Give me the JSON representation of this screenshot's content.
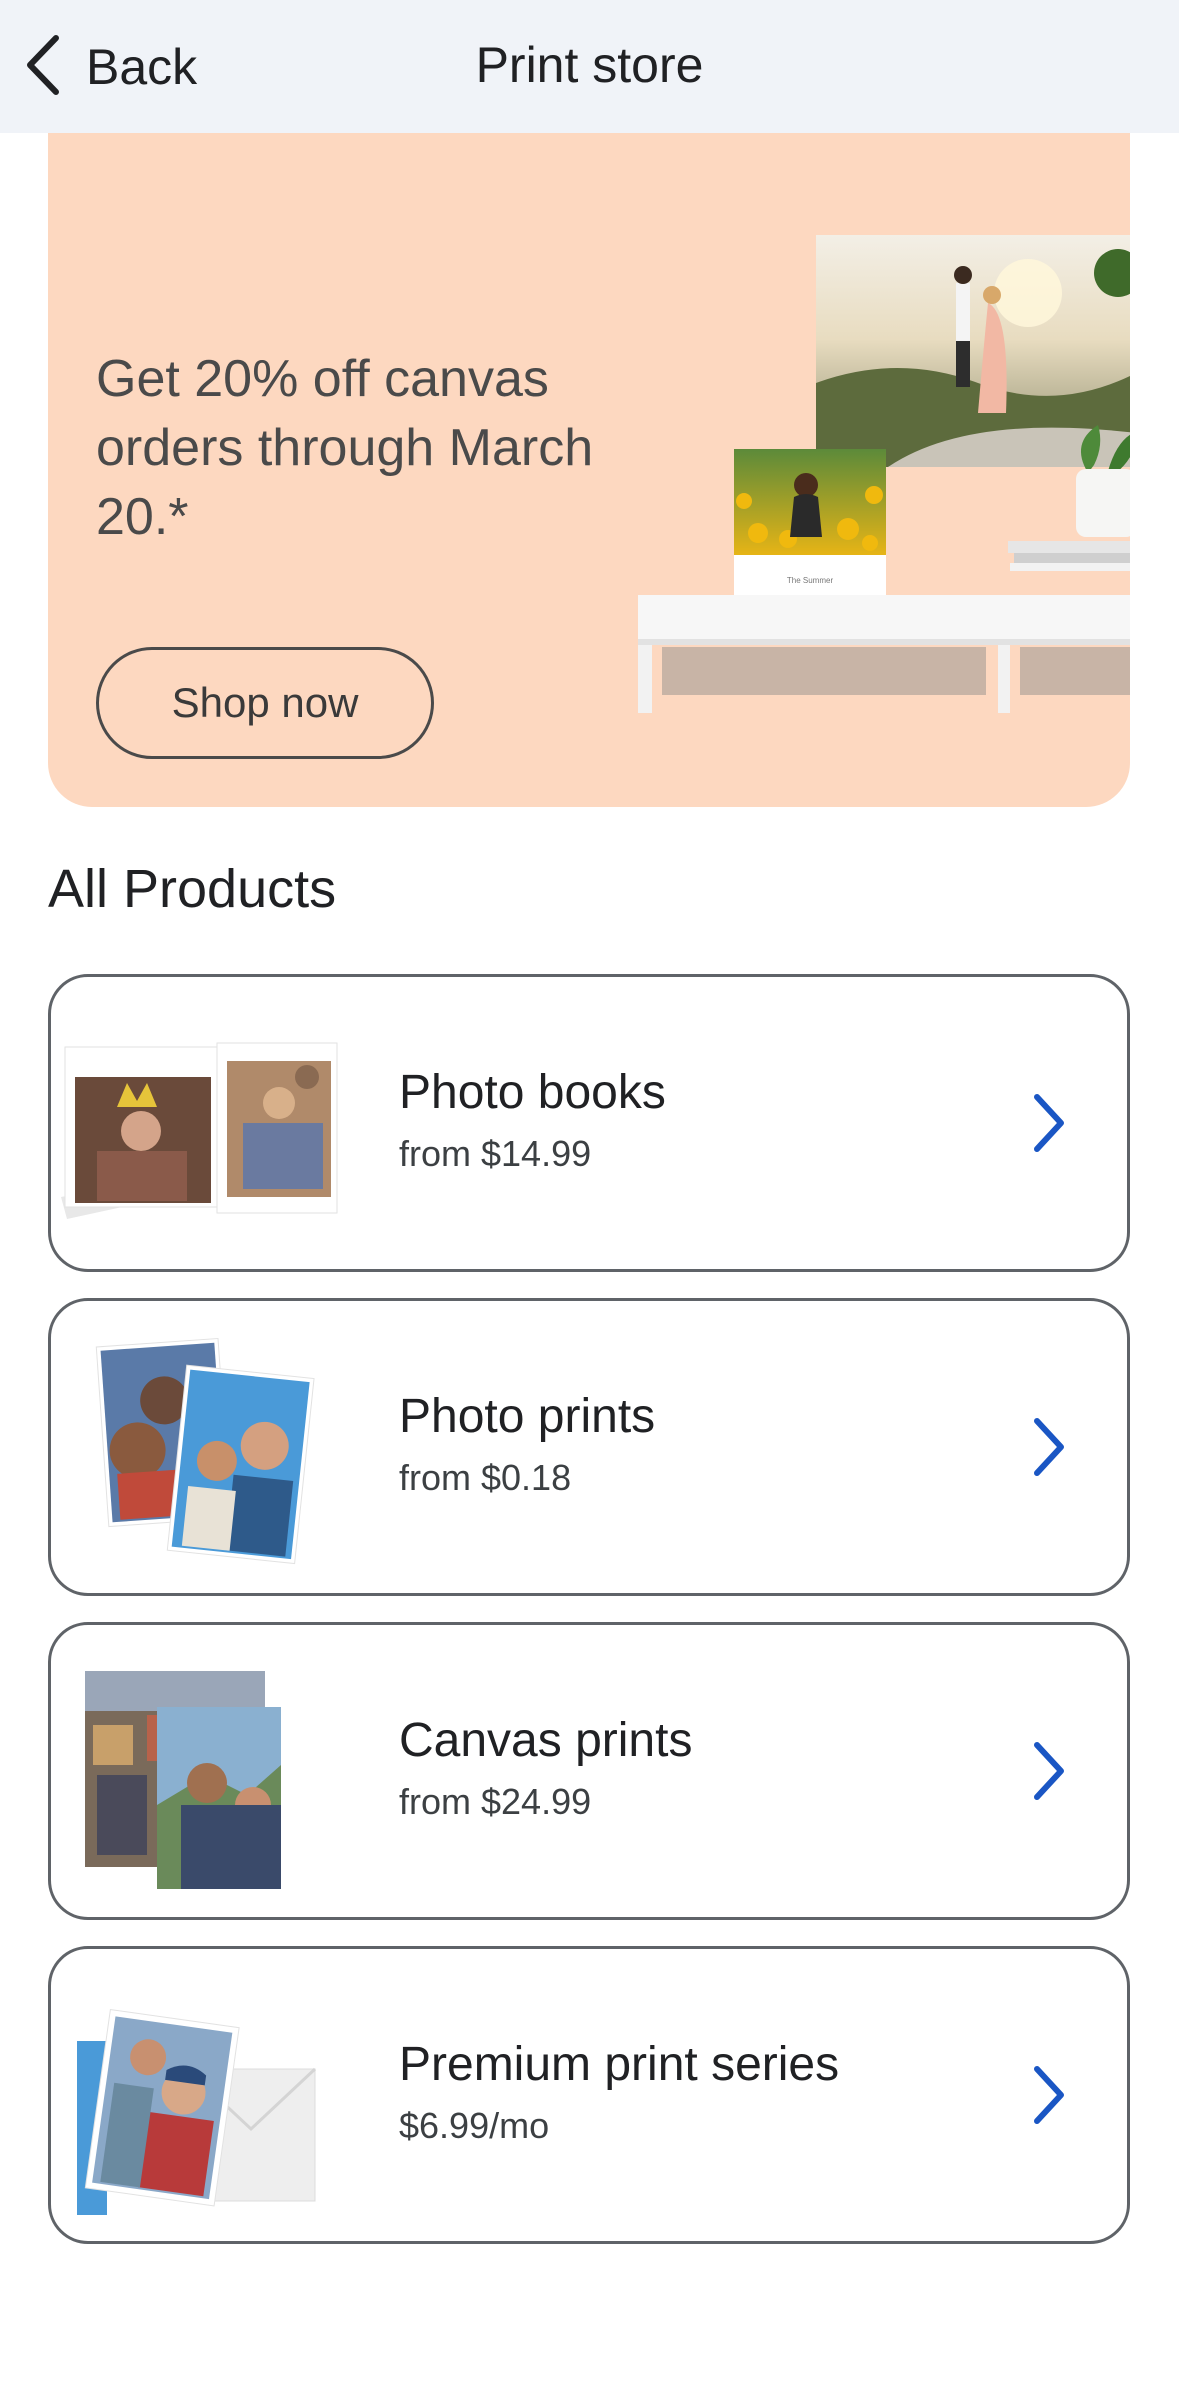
{
  "nav": {
    "back_label": "Back",
    "title": "Print store"
  },
  "promo": {
    "text": "Get 20% off canvas orders through March 20.*",
    "button_label": "Shop now",
    "book_caption": "The Summer"
  },
  "section_title": "All Products",
  "products": [
    {
      "title": "Photo books",
      "subtitle": "from $14.99"
    },
    {
      "title": "Photo prints",
      "subtitle": "from $0.18"
    },
    {
      "title": "Canvas prints",
      "subtitle": "from $24.99"
    },
    {
      "title": "Premium print series",
      "subtitle": "$6.99/mo"
    }
  ],
  "colors": {
    "nav_bg": "#f0f3f8",
    "promo_bg": "#fdd8c0",
    "chevron_accent": "#1a56c4",
    "card_border": "#5f6368"
  }
}
